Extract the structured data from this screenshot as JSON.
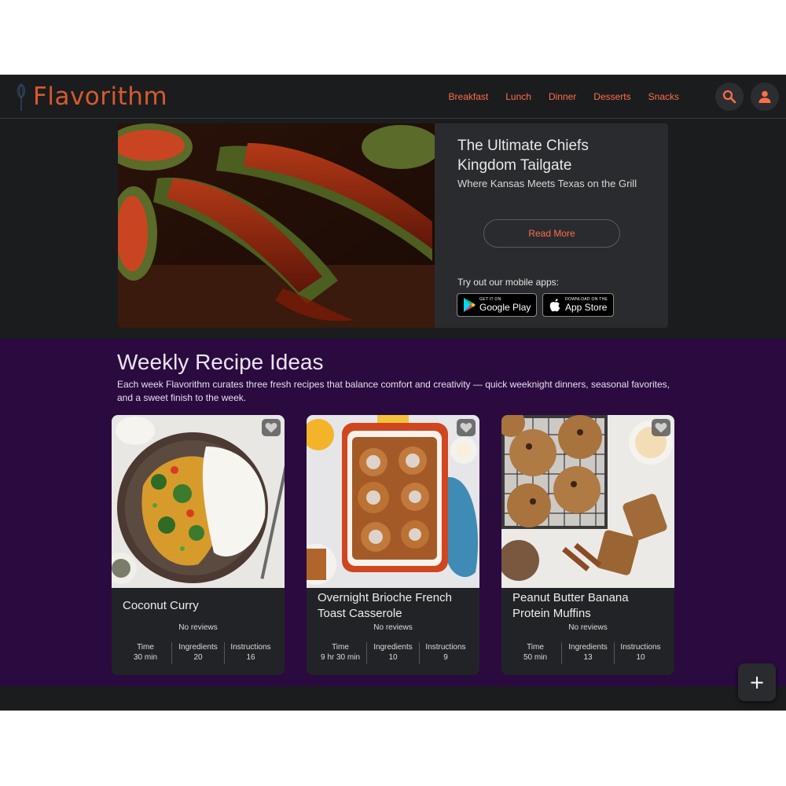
{
  "header": {
    "brand": "Flavorithm",
    "nav": [
      "Breakfast",
      "Lunch",
      "Dinner",
      "Desserts",
      "Snacks"
    ],
    "search_icon": "search-icon",
    "account_icon": "account-icon"
  },
  "hero": {
    "title": "The Ultimate Chiefs Kingdom Tailgate",
    "subtitle": "Where Kansas Meets Texas on the Grill",
    "read_more": "Read More",
    "apps_label": "Try out our mobile apps:",
    "google_play": {
      "small": "GET IT ON",
      "big": "Google Play"
    },
    "app_store": {
      "small": "Download on the",
      "big": "App Store"
    }
  },
  "weekly": {
    "title": "Weekly Recipe Ideas",
    "description": "Each week Flavorithm curates three fresh recipes that balance comfort and creativity — quick weeknight dinners, seasonal favorites, and a sweet finish to the week.",
    "stat_labels": {
      "time": "Time",
      "ingredients": "Ingredients",
      "instructions": "Instructions"
    },
    "cards": [
      {
        "title": "Coconut Curry",
        "reviews": "No reviews",
        "time": "30 min",
        "ingredients": "20",
        "instructions": "16"
      },
      {
        "title": "Overnight Brioche French Toast Casserole",
        "reviews": "No reviews",
        "time": "9 hr 30 min",
        "ingredients": "10",
        "instructions": "9"
      },
      {
        "title": "Peanut Butter Banana Protein Muffins",
        "reviews": "No reviews",
        "time": "50 min",
        "ingredients": "13",
        "instructions": "10"
      }
    ]
  },
  "fab": {
    "label": "+"
  },
  "colors": {
    "accent": "#ff6f47",
    "brand": "#d55a2f",
    "section_bg": "#2a0a3f",
    "page_bg": "#1b1c1e"
  }
}
